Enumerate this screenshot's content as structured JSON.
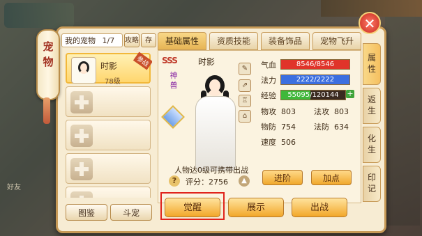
{
  "window": {
    "side_scroll_title": [
      "宠",
      "物"
    ],
    "friend_hud": "好友"
  },
  "pet_bar": {
    "count_label": "我的宠物",
    "count_value": "1/7",
    "strategy_button": "攻略",
    "store_button": "存"
  },
  "pets": [
    {
      "name": "时影",
      "level": "78级",
      "active": true,
      "badge": "参战"
    },
    {
      "empty": true
    },
    {
      "empty": true
    },
    {
      "empty": true
    },
    {
      "empty": true
    }
  ],
  "bottom_left_buttons": {
    "catalog": "图鉴",
    "pet_duel": "斗宠"
  },
  "tabs": [
    {
      "label": "基础属性",
      "active": true
    },
    {
      "label": "资质技能",
      "active": false
    },
    {
      "label": "装备饰品",
      "active": false
    },
    {
      "label": "宠物飞升",
      "active": false
    }
  ],
  "pet_detail": {
    "name": "时影",
    "grade_mark": "SSS",
    "rarity": "神兽",
    "carry_note": "人物达0级可携带出战",
    "score_label": "评分",
    "score_value": "2756"
  },
  "bars": [
    {
      "label": "气血",
      "text": "8546/8546",
      "fill": 1.0,
      "color": "#e0342a"
    },
    {
      "label": "法力",
      "text": "2222/2222",
      "fill": 1.0,
      "color": "#3c6fe0"
    },
    {
      "label": "经验",
      "text": "55095/120144",
      "fill": 0.4586,
      "color": "#3fb83a"
    }
  ],
  "attributes": [
    {
      "label": "物攻",
      "value": "803"
    },
    {
      "label": "法攻",
      "value": "803"
    },
    {
      "label": "物防",
      "value": "754"
    },
    {
      "label": "法防",
      "value": "634"
    },
    {
      "label": "速度",
      "value": "506"
    }
  ],
  "actions": {
    "advance": "进阶",
    "add_points": "加点",
    "awaken": "觉醒",
    "display": "展示",
    "deploy": "出战"
  },
  "side_tabs": [
    {
      "label": [
        "属",
        "性"
      ],
      "active": true
    },
    {
      "label": [
        "返",
        "生"
      ],
      "active": false
    },
    {
      "label": [
        "化",
        "生"
      ],
      "active": false
    },
    {
      "label": [
        "印",
        "记"
      ],
      "active": false
    }
  ],
  "icons": {
    "close": "close-icon",
    "edit": "pencil-icon",
    "share": "share-icon",
    "outfit": "shirt-icon",
    "temple": "temple-icon",
    "help": "question-icon",
    "upgrade": "arrow-up-icon"
  },
  "colors": {
    "highlight": "#e0231c",
    "accent": "#f2a72a"
  }
}
